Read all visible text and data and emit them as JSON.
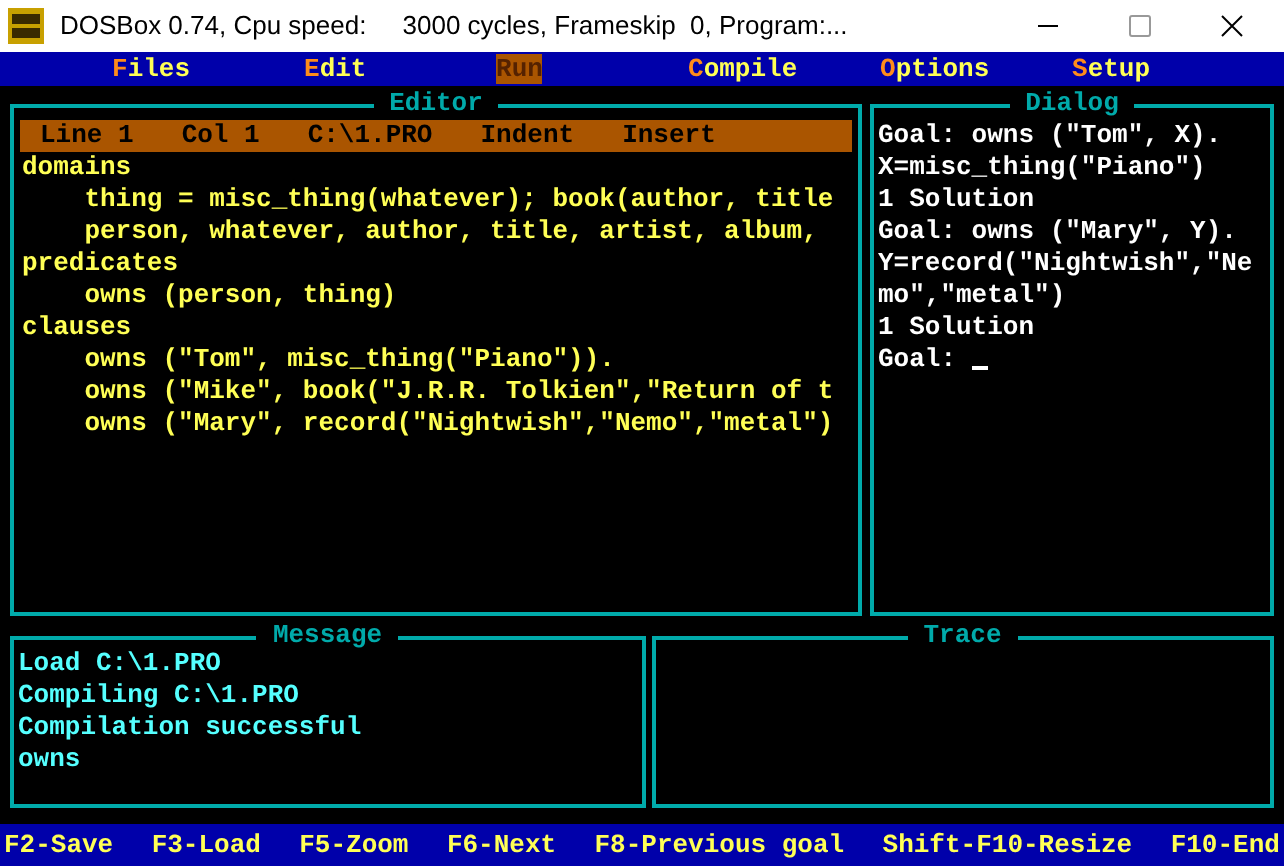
{
  "window": {
    "title": "DOSBox 0.74, Cpu speed:     3000 cycles, Frameskip  0, Program:..."
  },
  "menu": [
    {
      "label": "Files",
      "selected": false
    },
    {
      "label": "Edit",
      "selected": false
    },
    {
      "label": "Run",
      "selected": true
    },
    {
      "label": "Compile",
      "selected": false
    },
    {
      "label": "Options",
      "selected": false
    },
    {
      "label": "Setup",
      "selected": false
    }
  ],
  "editor": {
    "title": "Editor",
    "status": [
      "Line 1",
      "Col 1",
      "C:\\1.PRO",
      "Indent",
      "Insert"
    ],
    "lines": [
      "domains",
      "    thing = misc_thing(whatever); book(author, title",
      "    person, whatever, author, title, artist, album,",
      "predicates",
      "    owns (person, thing)",
      "clauses",
      "    owns (\"Tom\", misc_thing(\"Piano\")).",
      "    owns (\"Mike\", book(\"J.R.R. Tolkien\",\"Return of t",
      "    owns (\"Mary\", record(\"Nightwish\",\"Nemo\",\"metal\")"
    ]
  },
  "dialog": {
    "title": "Dialog",
    "lines": [
      "Goal: owns (\"Tom\", X).",
      "X=misc_thing(\"Piano\")",
      "1 Solution",
      "Goal: owns (\"Mary\", Y).",
      "Y=record(\"Nightwish\",\"Ne",
      "mo\",\"metal\")",
      "1 Solution",
      "Goal:"
    ],
    "cursor": true
  },
  "message": {
    "title": "Message",
    "lines": [
      "Load C:\\1.PRO",
      "Compiling C:\\1.PRO",
      "Compilation successful",
      "owns"
    ]
  },
  "trace": {
    "title": "Trace"
  },
  "function_keys": [
    "F2-Save",
    "F3-Load",
    "F5-Zoom",
    "F6-Next",
    "F8-Previous goal",
    "Shift-F10-Resize",
    "F10-End"
  ]
}
